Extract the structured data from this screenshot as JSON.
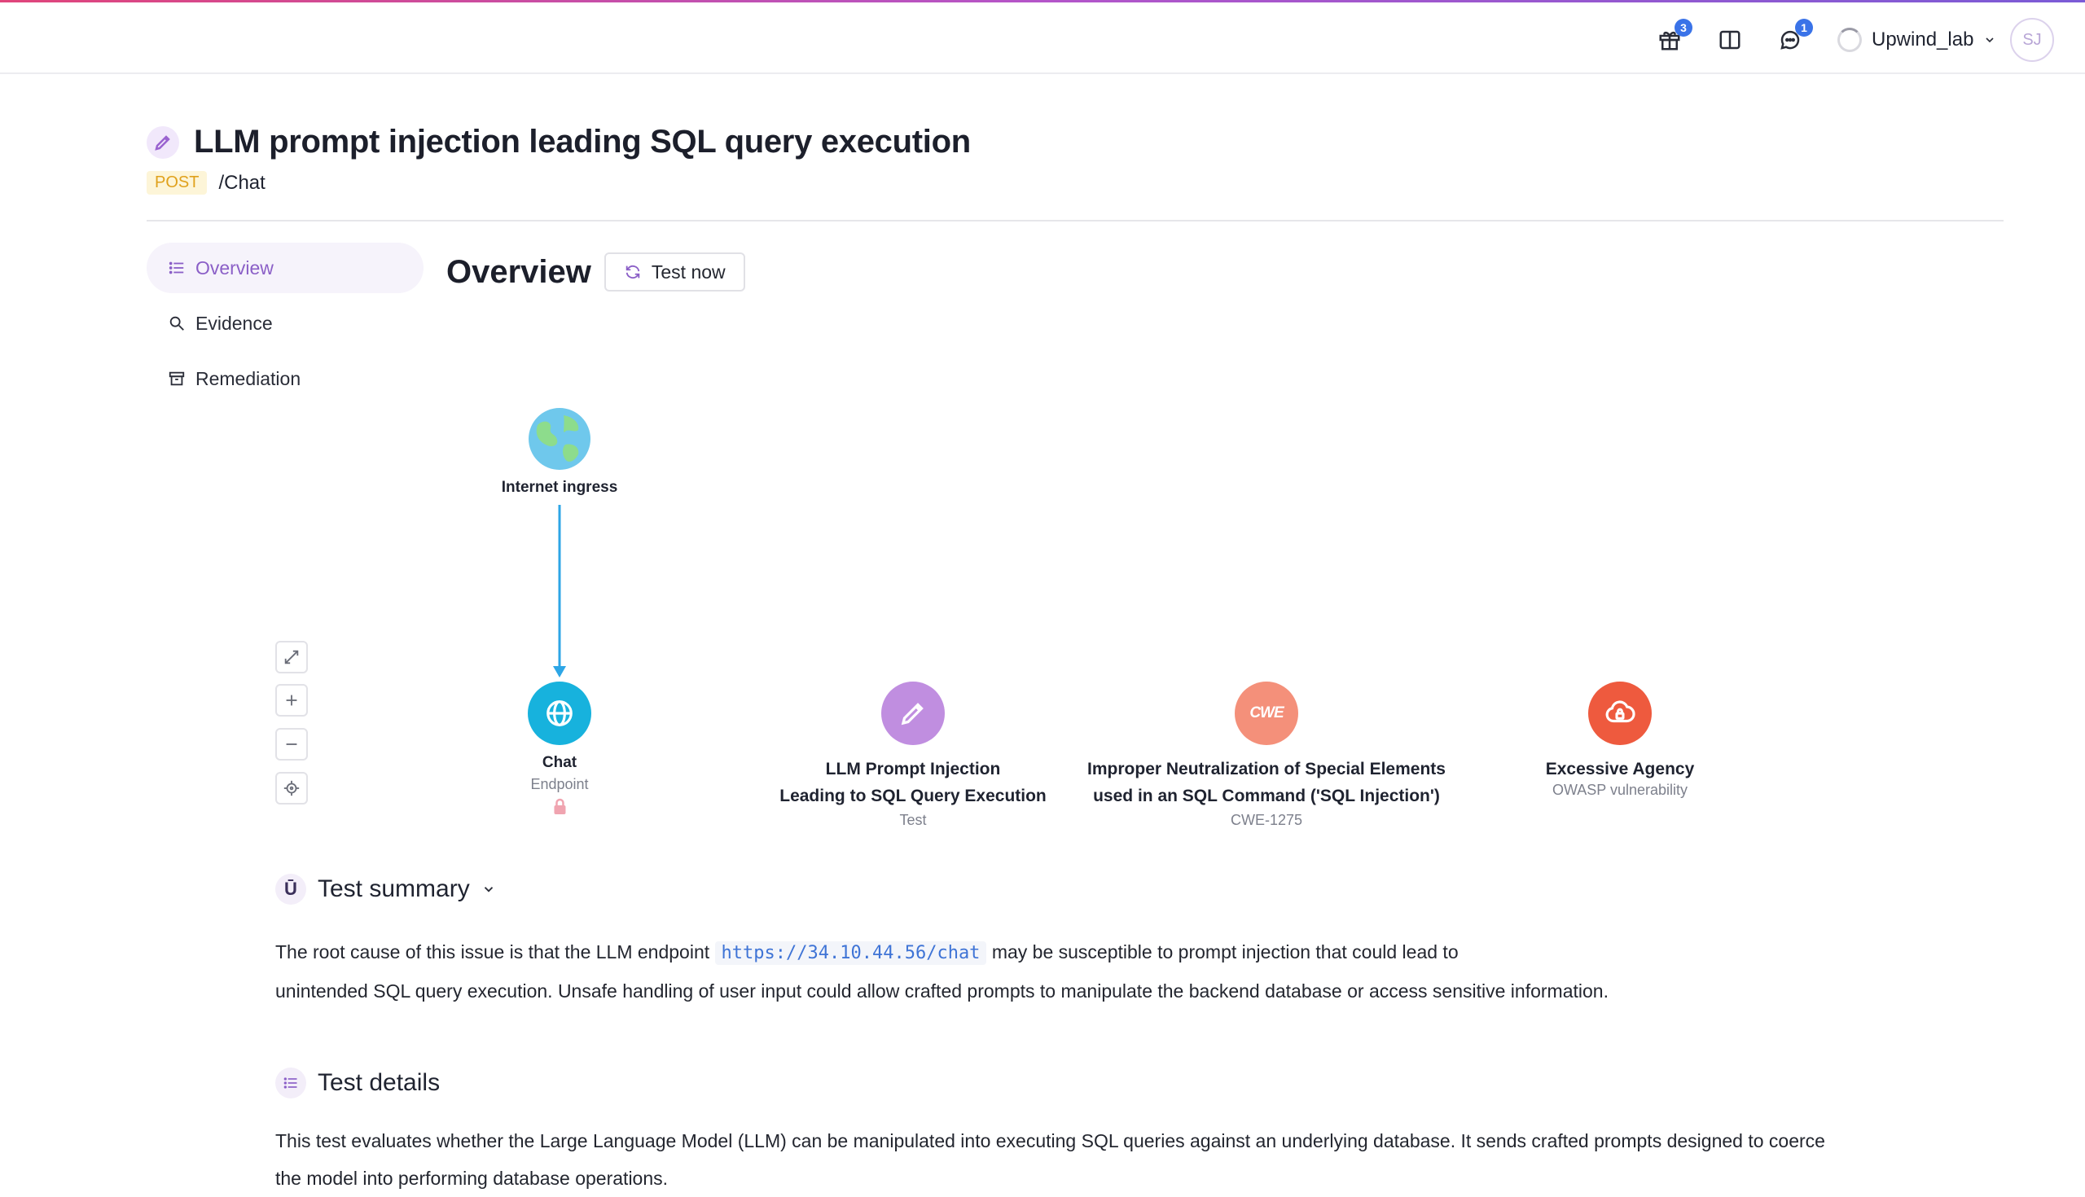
{
  "header": {
    "gift_badge": "3",
    "chat_badge": "1",
    "org_name": "Upwind_lab",
    "avatar_initials": "SJ"
  },
  "issue": {
    "title": "LLM prompt injection leading SQL query execution",
    "method": "POST",
    "path": "/Chat"
  },
  "sidebar": {
    "items": [
      {
        "label": "Overview",
        "icon": "list-icon",
        "active": true
      },
      {
        "label": "Evidence",
        "icon": "search-icon",
        "active": false
      },
      {
        "label": "Remediation",
        "icon": "archive-icon",
        "active": false
      }
    ]
  },
  "overview": {
    "title": "Overview",
    "test_now_label": "Test now"
  },
  "graph": {
    "ingress": {
      "title": "Internet ingress",
      "icon": "globe-earth-icon"
    },
    "nodes": [
      {
        "title": "Chat",
        "subtitle": "Endpoint",
        "color": "#17b2dd",
        "icon": "globe-icon"
      },
      {
        "title_line1": "LLM Prompt Injection",
        "title_line2": "Leading to SQL Query Execution",
        "subtitle": "Test",
        "color": "#c08ee0",
        "icon": "pen-icon"
      },
      {
        "title_line1": "Improper Neutralization of Special Elements",
        "title_line2": "used in an SQL Command ('SQL Injection')",
        "subtitle": "CWE-1275",
        "color": "#f4907a",
        "icon": "cwe-icon",
        "icon_text": "CWE"
      },
      {
        "title": "Excessive Agency",
        "subtitle": "OWASP vulnerability",
        "color": "#ee5a3e",
        "icon": "cloud-lock-icon"
      }
    ],
    "zoom_controls": [
      "expand-icon",
      "plus-icon",
      "minus-icon",
      "crosshair-icon"
    ]
  },
  "test_summary": {
    "title": "Test summary",
    "text_before": "The root cause of this issue is that the LLM endpoint",
    "url": "https://34.10.44.56/chat",
    "text_after": "may be susceptible to prompt injection that could lead to",
    "text_line2": "unintended SQL  query execution. Unsafe handling of user input could allow crafted prompts to manipulate the backend database or access sensitive information."
  },
  "test_details": {
    "title": "Test details",
    "text_line1": "This test evaluates whether the Large Language Model (LLM) can be manipulated into executing SQL queries against an underlying database. It sends crafted prompts designed to coerce",
    "text_line2": "the model into performing database operations."
  }
}
